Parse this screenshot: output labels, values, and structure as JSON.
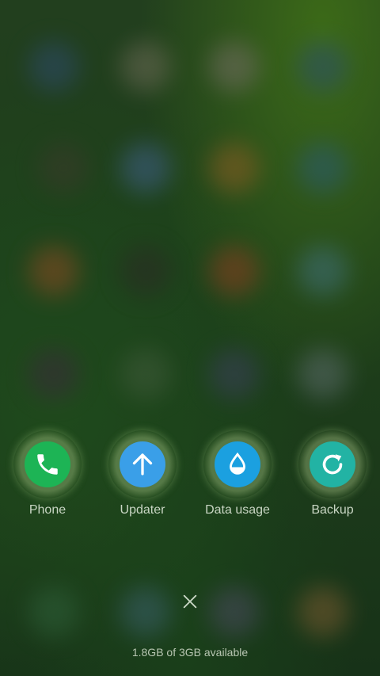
{
  "background": {
    "description_colors": [
      "#2d4a6a",
      "#6b6a55",
      "#726c62",
      "#2b4f6a",
      "#3a3a2a",
      "#3f5f88",
      "#8a5d22",
      "#2a5a70",
      "#8a4a22",
      "#2b2a24",
      "#8a3d20",
      "#3f6f7a",
      "#3a2a3a",
      "#3f5a3a",
      "#3a3f5a",
      "#5a6a6a",
      "#2f5f3a",
      "#3a5f6a",
      "#4a4a5f",
      "#7a5a30"
    ]
  },
  "recent_apps": [
    {
      "label": "Phone",
      "icon": "phone-icon",
      "color": "#1db455"
    },
    {
      "label": "Updater",
      "icon": "arrow-up-icon",
      "color": "#3a9fe8"
    },
    {
      "label": "Data usage",
      "icon": "water-drop-icon",
      "color": "#1ba0e0"
    },
    {
      "label": "Backup",
      "icon": "refresh-icon",
      "color": "#22b3a4"
    }
  ],
  "close_all": {
    "icon": "close-icon"
  },
  "memory_status": "1.8GB of 3GB available"
}
